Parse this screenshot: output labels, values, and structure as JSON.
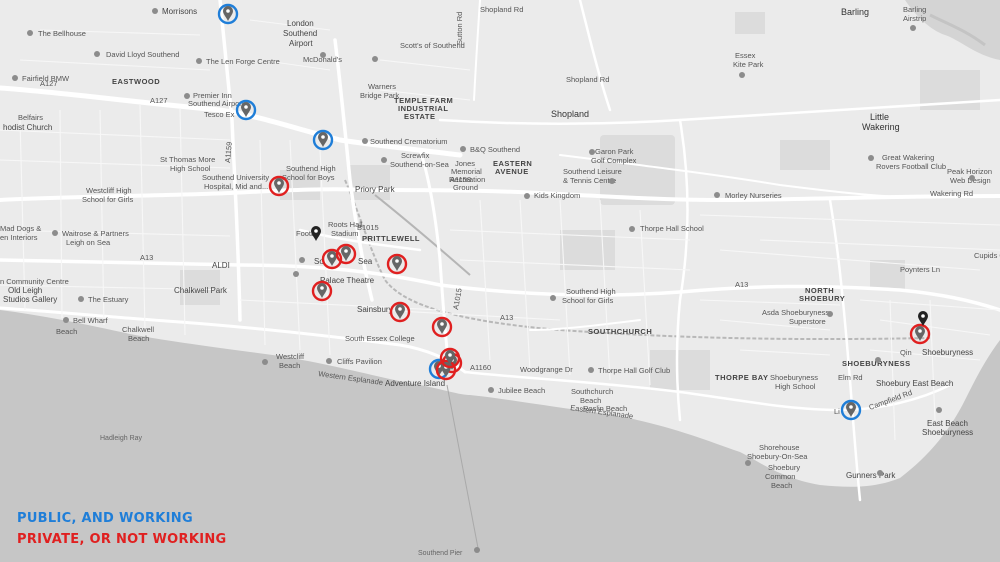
{
  "colors": {
    "land": "#ebebeb",
    "sea": "#c6c6c6",
    "road": "#ffffff",
    "public_working": "#1f7ed8",
    "private_not_working": "#e02020"
  },
  "legend": {
    "public_working": "PUBLIC, AND WORKING",
    "private_not_working": "PRIVATE, OR NOT WORKING"
  },
  "labels": {
    "morrisons": "Morrisons",
    "bellhouse": "The Bellhouse",
    "david_lloyd": "David Lloyd Southend",
    "len_forge": "The Len Forge Centre",
    "eastwood": "EASTWOOD",
    "fairfield_bmw": "Fairfield BMW",
    "premier_inn_1": "Premier Inn",
    "premier_inn_2": "Southend Airport",
    "tesco": "Tesco Ex",
    "belfairs_1": "Belfairs",
    "belfairs_2": "hodist Church",
    "airport_1": "London",
    "airport_2": "Southend",
    "airport_3": "Airport",
    "mcdonalds": "McDonald's",
    "scotts": "Scott's of Southend",
    "warners_1": "Warners",
    "warners_2": "Bridge Park",
    "temple_farm_1": "TEMPLE FARM",
    "temple_farm_2": "INDUSTRIAL",
    "temple_farm_3": "ESTATE",
    "shopland": "Shopland",
    "essex_kite_1": "Essex",
    "essex_kite_2": "Kite Park",
    "barling_1": "Barling",
    "barling_2": "Barling",
    "barling_3": "Airstrip",
    "little_wakering_1": "Little",
    "little_wakering_2": "Wakering",
    "st_thomas_1": "St Thomas More",
    "st_thomas_2": "High School",
    "hospital_1": "Southend University",
    "hospital_2": "Hospital, Mid and...",
    "southend_high_boys_1": "Southend High",
    "southend_high_boys_2": "School for Boys",
    "crematorium": "Southend Crematorium",
    "screwfix_1": "Screwfix",
    "screwfix_2": "Southend-on-Sea",
    "bq": "B&Q Southend",
    "jones_1": "Jones",
    "jones_2": "Memorial",
    "jones_3": "Recreation",
    "jones_4": "Ground",
    "eastern_1": "EASTERN",
    "eastern_2": "AVENUE",
    "garon_1": "Garon Park",
    "garon_2": "Golf Complex",
    "leisure_1": "Southend Leisure",
    "leisure_2": "& Tennis Centre",
    "kids_kingdom": "Kids Kingdom",
    "morley": "Morley Nurseries",
    "great_wakering_1": "Great Wakering",
    "great_wakering_2": "Rovers Football Club",
    "peak_horizon_1": "Peak Horizon",
    "peak_horizon_2": "Web Design",
    "westcliff_girls_1": "Westcliff High",
    "westcliff_girls_2": "School for Girls",
    "priory": "Priory Park",
    "roots_hall_1": "Roots Hall",
    "roots_hall_2": "Stadium",
    "football": "Footb",
    "prittlewell": "PRITTLEWELL",
    "mad_dogs_1": "Mad Dogs &",
    "mad_dogs_2": "en Interiors",
    "waitrose_1": "Waitrose & Partners",
    "waitrose_2": "Leigh on Sea",
    "aldi": "ALDI",
    "sea_label": "Sea",
    "sou": "So",
    "palace": "Palace Theatre",
    "thorpe_hall_school": "Thorpe Hall School",
    "cupids": "Cupids C",
    "community_1": "n Community Centre",
    "old_leigh_1": "Old Leigh",
    "old_leigh_2": "Studios Gallery",
    "estuary": "The Estuary",
    "chalkwell_park": "Chalkwell Park",
    "sainsbury": "Sainsbury",
    "southend_high_girls_1": "Southend High",
    "southend_high_girls_2": "School for Girls",
    "north_shoebury_1": "NORTH",
    "north_shoebury_2": "SHOEBURY",
    "asda_1": "Asda Shoeburyness",
    "asda_2": "Superstore",
    "bell_wharf_1": "Bell Wharf",
    "bell_wharf_2": "Beach",
    "chalkwell_beach_1": "Chalkwell",
    "chalkwell_beach_2": "Beach",
    "south_essex": "South Essex College",
    "southchurch": "SOUTHCHURCH",
    "qin_shoebury_1": "Qin",
    "qin_shoebury_2": "Shoeburyness",
    "shoeburyness_area": "SHOEBURYNESS",
    "westcliff_beach_1": "Westcliff",
    "westcliff_beach_2": "Beach",
    "cliffs_pavilion": "Cliffs Pavilion",
    "adventure_island": "Adventure Island",
    "jubilee": "Jubilee Beach",
    "thorpe_hall_golf": "Thorpe Hall Golf Club",
    "thorpe_bay": "THORPE BAY",
    "southchurch_beach_1": "Southchurch",
    "southchurch_beach_2": "Beach",
    "roslin": "Roslin Beach",
    "shoeburyness_high_1": "Shoeburyness",
    "shoeburyness_high_2": "High School",
    "shoebury_east_beach": "Shoebury East Beach",
    "east_beach_1": "East Beach",
    "east_beach_2": "Shoeburyness",
    "lidl": "Li",
    "shorehouse_1": "Shorehouse",
    "shorehouse_2": "Shoebury-On-Sea",
    "shoebury_common_1": "Shoebury",
    "shoebury_common_2": "Common",
    "shoebury_common_3": "Beach",
    "gunners": "Gunners Park",
    "hadleigh_ray": "Hadleigh Ray",
    "southend_pier": "Southend Pier"
  },
  "road_labels": {
    "a127": "A127",
    "a127b": "A127",
    "a1159": "A1159",
    "a13": "A13",
    "a13b": "A13",
    "a13c": "A13",
    "a1160": "A1160",
    "b1015": "B1015",
    "a1158": "A1158",
    "shopland_rd": "Shopland Rd",
    "shopland_rd2": "Shopland Rd",
    "sutton_rd": "Sutton Rd",
    "kent_elms": "A1015",
    "woodgrange": "Woodgrange Dr",
    "eastern_esp": "Eastern Esplanade",
    "western_esp": "Western Esplanade",
    "campfield": "Campfield Rd",
    "elm_rd": "Elm Rd",
    "poynters": "Poynters Ln",
    "wakering_rd": "Wakering Rd"
  },
  "markers": [
    {
      "kind": "public_working",
      "icon": "map-pin-icon"
    },
    {
      "kind": "public_working",
      "icon": "map-pin-icon"
    },
    {
      "kind": "public_working",
      "icon": "map-pin-icon"
    },
    {
      "kind": "public_working",
      "icon": "map-pin-icon"
    },
    {
      "kind": "public_working",
      "icon": "map-pin-icon"
    },
    {
      "kind": "private_not_working",
      "icon": "map-pin-icon"
    },
    {
      "kind": "private_not_working",
      "icon": "map-pin-icon"
    },
    {
      "kind": "private_not_working",
      "icon": "map-pin-icon"
    },
    {
      "kind": "private_not_working",
      "icon": "map-pin-icon"
    },
    {
      "kind": "private_not_working",
      "icon": "map-pin-icon"
    },
    {
      "kind": "private_not_working",
      "icon": "map-pin-icon"
    },
    {
      "kind": "private_not_working",
      "icon": "map-pin-icon"
    },
    {
      "kind": "private_not_working",
      "icon": "map-pin-icon"
    },
    {
      "kind": "private_not_working",
      "icon": "map-pin-icon"
    },
    {
      "kind": "private_not_working",
      "icon": "map-pin-icon"
    },
    {
      "kind": "private_not_working",
      "icon": "map-pin-icon"
    },
    {
      "kind": "unmarked",
      "icon": "map-pin-icon"
    },
    {
      "kind": "unmarked",
      "icon": "map-pin-icon"
    }
  ]
}
